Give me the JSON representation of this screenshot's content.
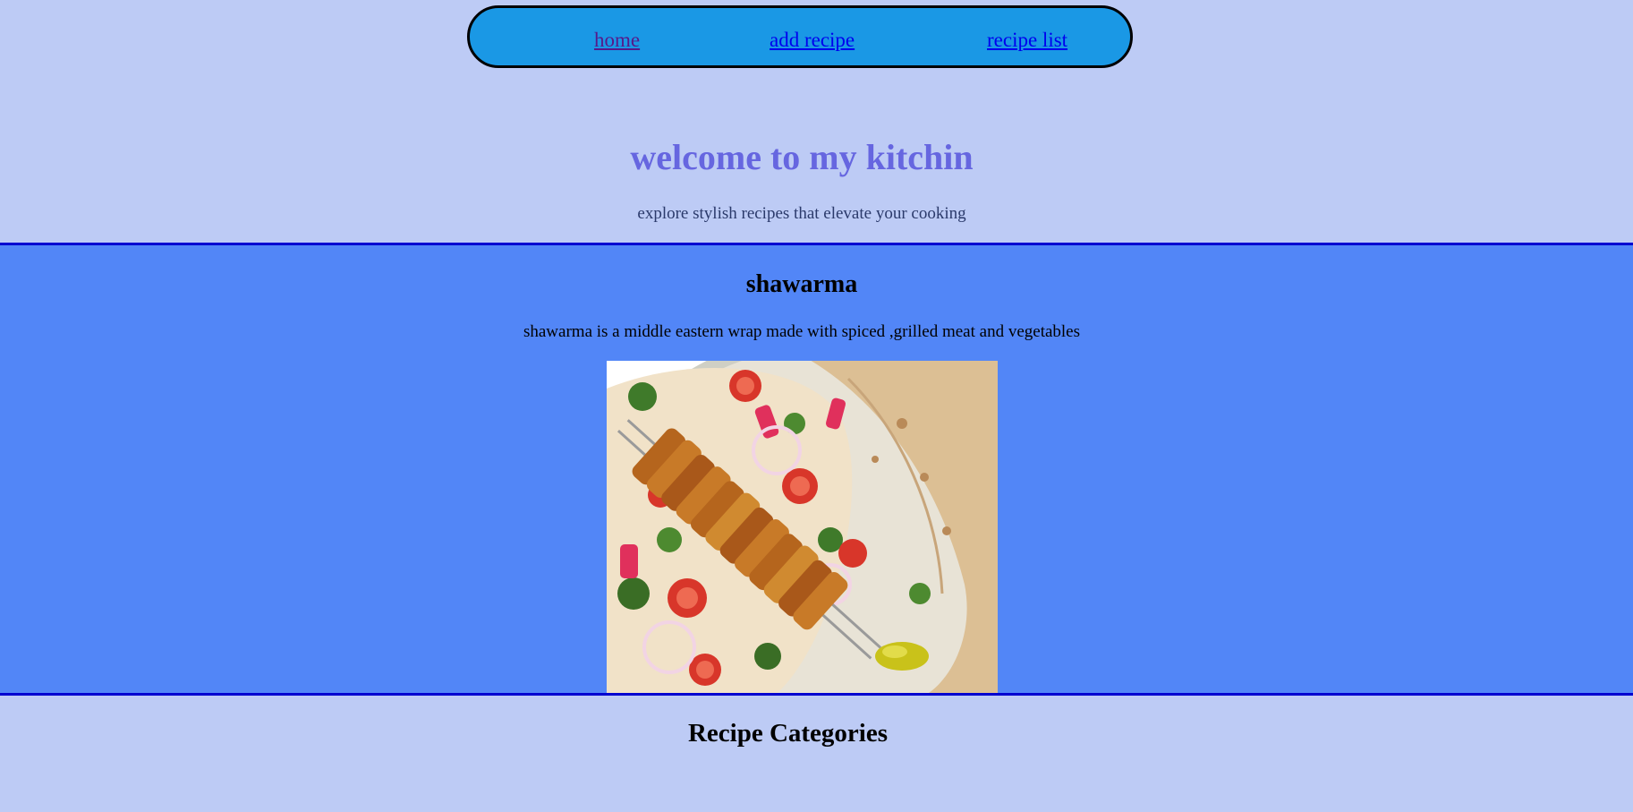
{
  "nav": {
    "links": [
      {
        "label": "home",
        "visited": true
      },
      {
        "label": "add recipe",
        "visited": false
      },
      {
        "label": "recipe list",
        "visited": false
      }
    ]
  },
  "hero": {
    "title": "welcome to my kitchin",
    "subtitle": "explore stylish recipes that elevate your cooking"
  },
  "featured": {
    "title": "shawarma",
    "description": "shawarma is a middle eastern wrap made with spiced ,grilled meat and vegetables",
    "image_alt": "shawarma"
  },
  "categories": {
    "title": "Recipe Categories"
  },
  "colors": {
    "page_background": "#bdcbf5",
    "nav_background": "#1a98e5",
    "featured_background": "#5286f7",
    "hero_title": "#6666e0",
    "divider": "#0000d0"
  }
}
